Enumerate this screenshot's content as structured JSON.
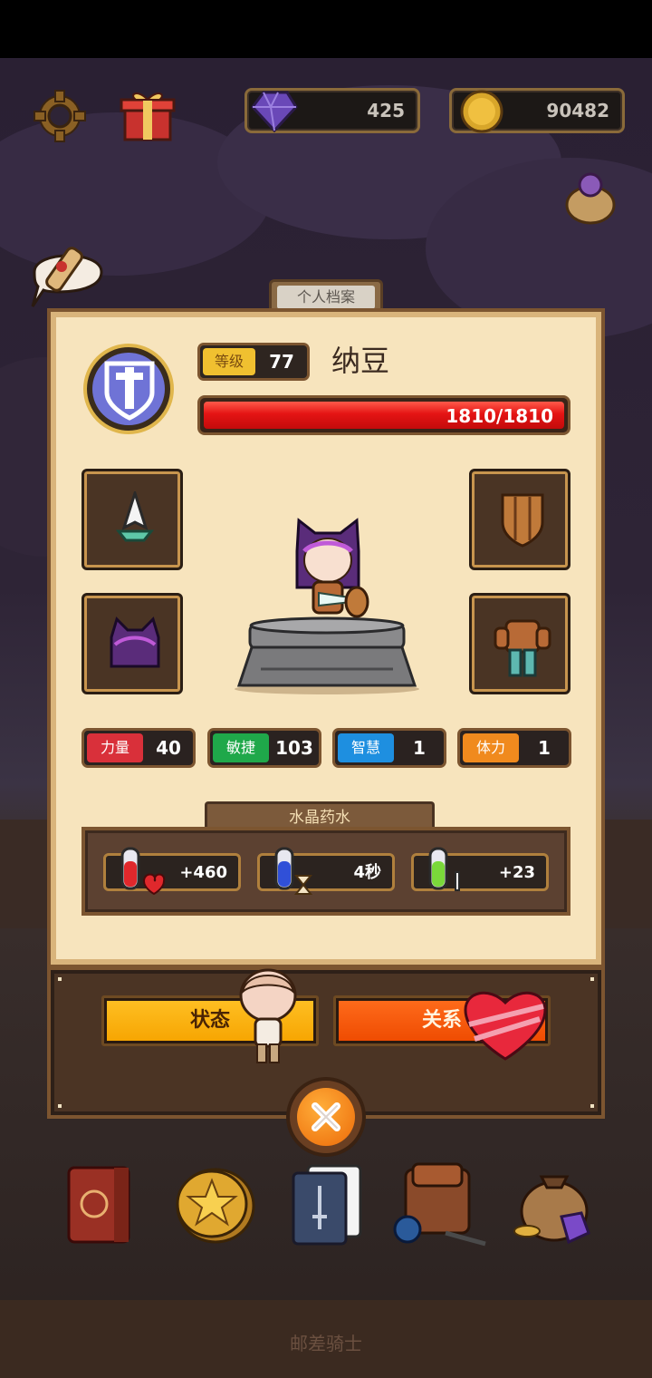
{
  "top_bar": {
    "gems": "425",
    "coins": "90482"
  },
  "profile": {
    "tab_title": "个人档案",
    "level_label": "等级",
    "level_value": "77",
    "player_name": "纳豆",
    "hp_text": "1810/1810",
    "hp_fraction": 1.0
  },
  "stats": [
    {
      "label": "力量",
      "value": "40",
      "color": "#d9303a"
    },
    {
      "label": "敏捷",
      "value": "103",
      "color": "#1fa84a"
    },
    {
      "label": "智慧",
      "value": "1",
      "color": "#1e8fe0"
    },
    {
      "label": "体力",
      "value": "1",
      "color": "#f08a1e"
    }
  ],
  "potions": {
    "title": "水晶药水",
    "items": [
      {
        "value": "+460",
        "icon": "health-potion-icon"
      },
      {
        "value": "4秒",
        "icon": "time-potion-icon"
      },
      {
        "value": "+23",
        "icon": "attack-potion-icon"
      }
    ]
  },
  "buttons": {
    "status": "状态",
    "relation": "关系"
  },
  "footer": {
    "title": "邮差骑士"
  },
  "colors": {
    "panel_bg": "#f7e4bd",
    "panel_border": "#7c5530",
    "hp_red": "#e41414",
    "level_yellow": "#f0c030"
  }
}
